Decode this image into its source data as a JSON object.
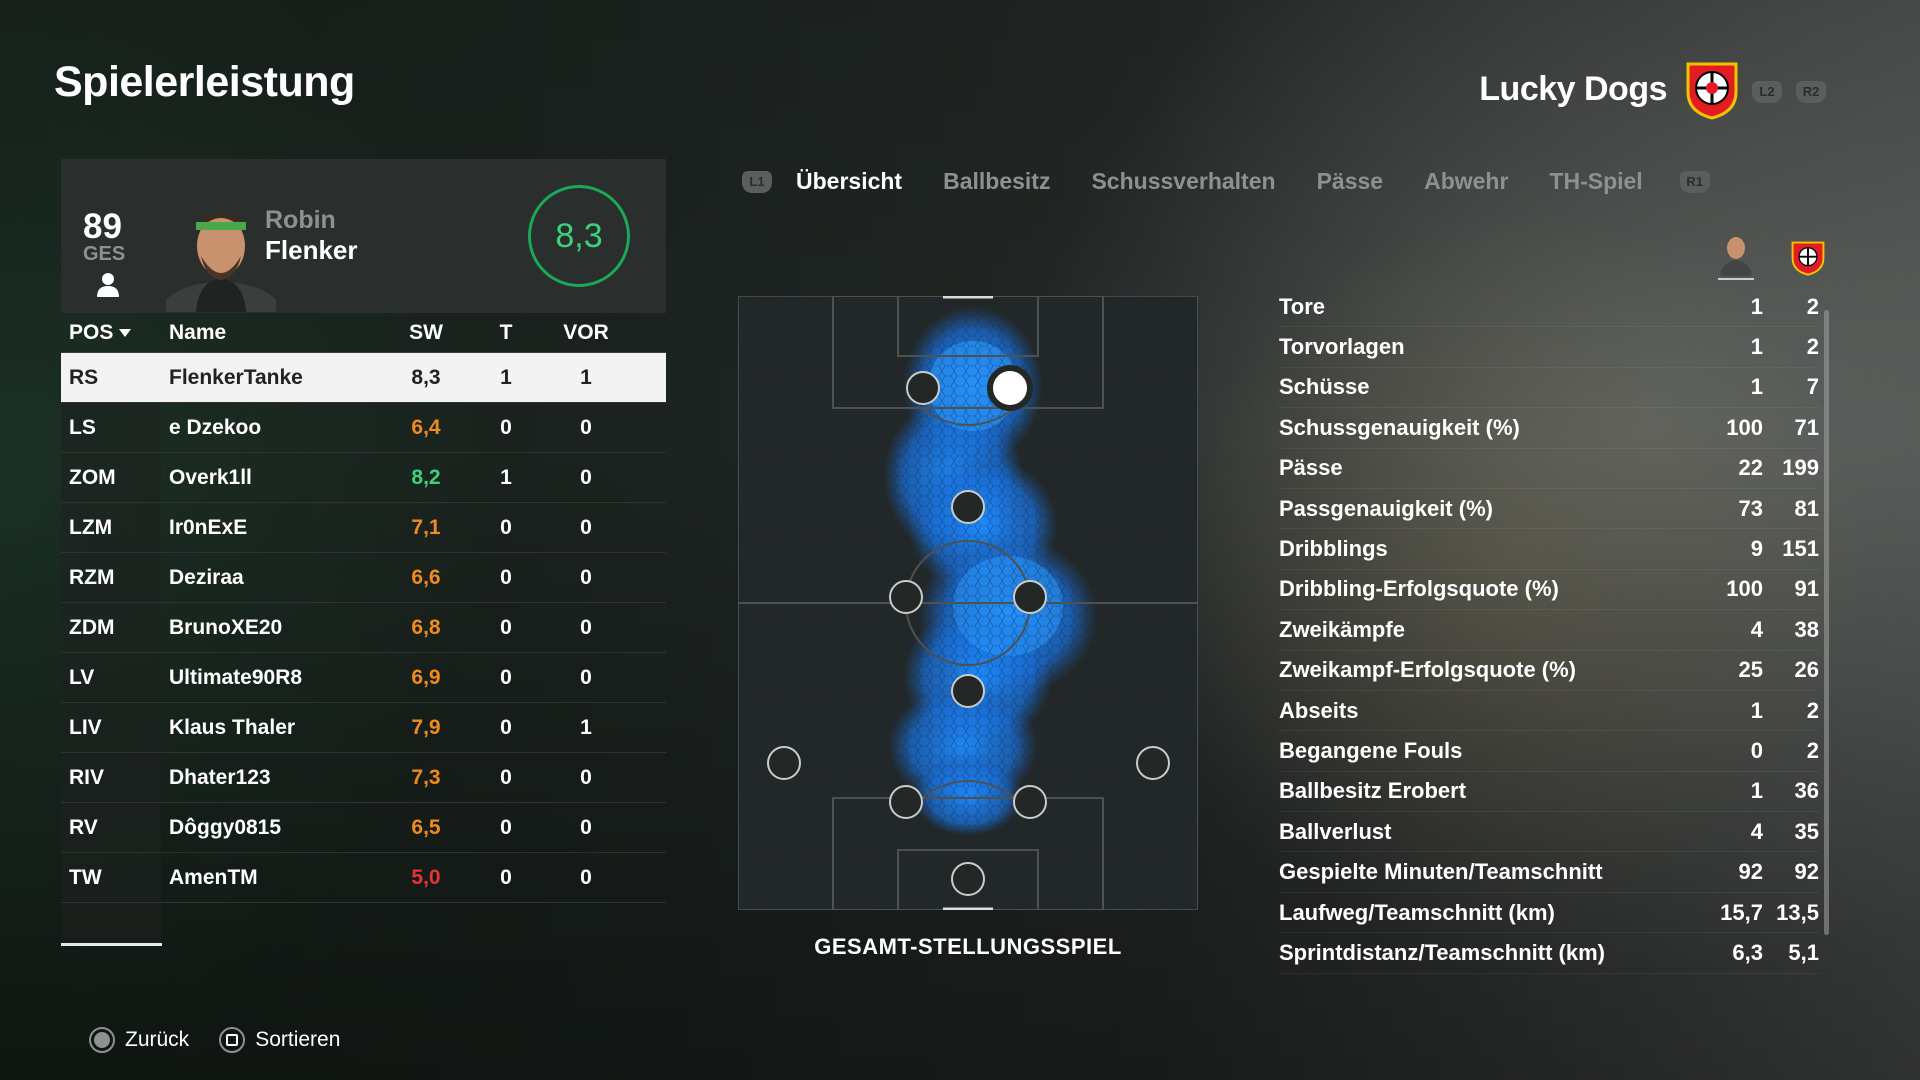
{
  "page": {
    "title": "Spielerleistung"
  },
  "team": {
    "name": "Lucky Dogs",
    "hints": [
      "L2",
      "R2"
    ]
  },
  "player": {
    "overall": "89",
    "overall_label": "GES",
    "first_name": "Robin",
    "last_name": "Flenker",
    "rating": "8,3"
  },
  "table": {
    "headers": {
      "pos": "POS",
      "name": "Name",
      "sw": "SW",
      "t": "T",
      "vor": "VOR"
    },
    "rows": [
      {
        "pos": "RS",
        "name": "FlenkerTanke",
        "sw": "8,3",
        "t": "1",
        "vor": "1",
        "color": "#222222"
      },
      {
        "pos": "LS",
        "name": "e Dzekoo",
        "sw": "6,4",
        "t": "0",
        "vor": "0",
        "color": "#f08a1c"
      },
      {
        "pos": "ZOM",
        "name": "Overk1ll",
        "sw": "8,2",
        "t": "1",
        "vor": "0",
        "color": "#3dd17a"
      },
      {
        "pos": "LZM",
        "name": "Ir0nExE",
        "sw": "7,1",
        "t": "0",
        "vor": "0",
        "color": "#f08a1c"
      },
      {
        "pos": "RZM",
        "name": "Deziraa",
        "sw": "6,6",
        "t": "0",
        "vor": "0",
        "color": "#f08a1c"
      },
      {
        "pos": "ZDM",
        "name": "BrunoXE20",
        "sw": "6,8",
        "t": "0",
        "vor": "0",
        "color": "#f08a1c"
      },
      {
        "pos": "LV",
        "name": "Ultimate90R8",
        "sw": "6,9",
        "t": "0",
        "vor": "0",
        "color": "#f08a1c"
      },
      {
        "pos": "LIV",
        "name": "Klaus Thaler",
        "sw": "7,9",
        "t": "0",
        "vor": "1",
        "color": "#f08a1c"
      },
      {
        "pos": "RIV",
        "name": "Dhater123",
        "sw": "7,3",
        "t": "0",
        "vor": "0",
        "color": "#f08a1c"
      },
      {
        "pos": "RV",
        "name": "Dôggy0815",
        "sw": "6,5",
        "t": "0",
        "vor": "0",
        "color": "#f08a1c"
      },
      {
        "pos": "TW",
        "name": "AmenTM",
        "sw": "5,0",
        "t": "0",
        "vor": "0",
        "color": "#e8323a"
      }
    ]
  },
  "tabs": {
    "left_hint": "L1",
    "right_hint": "R1",
    "items": [
      "Übersicht",
      "Ballbesitz",
      "Schussverhalten",
      "Pässe",
      "Abwehr",
      "TH-Spiel"
    ],
    "active": 0
  },
  "pitch": {
    "caption": "GESAMT-STELLUNGSSPIEL"
  },
  "stats": [
    {
      "label": "Tore",
      "player": "1",
      "team": "2"
    },
    {
      "label": "Torvorlagen",
      "player": "1",
      "team": "2"
    },
    {
      "label": "Schüsse",
      "player": "1",
      "team": "7"
    },
    {
      "label": "Schussgenauigkeit (%)",
      "player": "100",
      "team": "71"
    },
    {
      "label": "Pässe",
      "player": "22",
      "team": "199"
    },
    {
      "label": "Passgenauigkeit (%)",
      "player": "73",
      "team": "81"
    },
    {
      "label": "Dribblings",
      "player": "9",
      "team": "151"
    },
    {
      "label": "Dribbling-Erfolgsquote (%)",
      "player": "100",
      "team": "91"
    },
    {
      "label": "Zweikämpfe",
      "player": "4",
      "team": "38"
    },
    {
      "label": "Zweikampf-Erfolgsquote (%)",
      "player": "25",
      "team": "26"
    },
    {
      "label": "Abseits",
      "player": "1",
      "team": "2"
    },
    {
      "label": "Begangene Fouls",
      "player": "0",
      "team": "2"
    },
    {
      "label": "Ballbesitz Erobert",
      "player": "1",
      "team": "36"
    },
    {
      "label": "Ballverlust",
      "player": "4",
      "team": "35"
    },
    {
      "label": "Gespielte Minuten/Teamschnitt",
      "player": "92",
      "team": "92"
    },
    {
      "label": "Laufweg/Teamschnitt (km)",
      "player": "15,7",
      "team": "13,5"
    },
    {
      "label": "Sprintdistanz/Teamschnitt (km)",
      "player": "6,3",
      "team": "5,1"
    }
  ],
  "footer": {
    "back": "Zurück",
    "sort": "Sortieren"
  },
  "colors": {
    "accent_green": "#1aa95a",
    "heatmap_blue": "#1e8cff"
  }
}
